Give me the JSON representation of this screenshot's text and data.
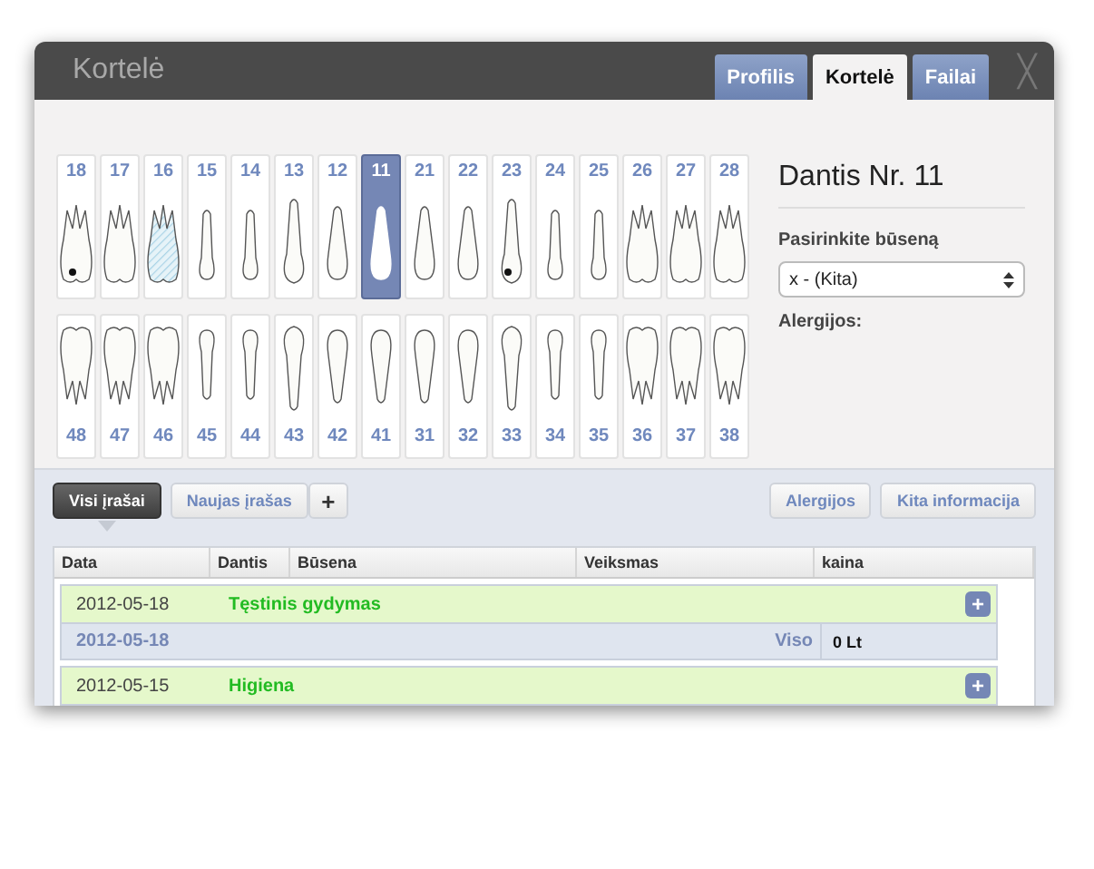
{
  "window": {
    "title": "Kortelė",
    "close_label": "╳"
  },
  "tabs": [
    {
      "label": "Profilis",
      "selected": false
    },
    {
      "label": "Kortelė",
      "selected": true
    },
    {
      "label": "Failai",
      "selected": false
    }
  ],
  "upper_teeth": [
    {
      "number": "18",
      "kind": "molar",
      "caries": true,
      "treated": false,
      "selected": false
    },
    {
      "number": "17",
      "kind": "molar",
      "caries": false,
      "treated": false,
      "selected": false
    },
    {
      "number": "16",
      "kind": "molar",
      "caries": false,
      "treated": true,
      "selected": false
    },
    {
      "number": "15",
      "kind": "premolar",
      "caries": false,
      "treated": false,
      "selected": false
    },
    {
      "number": "14",
      "kind": "premolar",
      "caries": false,
      "treated": false,
      "selected": false
    },
    {
      "number": "13",
      "kind": "canine",
      "caries": false,
      "treated": false,
      "selected": false
    },
    {
      "number": "12",
      "kind": "incisor",
      "caries": false,
      "treated": false,
      "selected": false
    },
    {
      "number": "11",
      "kind": "incisor",
      "caries": false,
      "treated": false,
      "selected": true
    },
    {
      "number": "21",
      "kind": "incisor",
      "caries": false,
      "treated": false,
      "selected": false
    },
    {
      "number": "22",
      "kind": "incisor",
      "caries": false,
      "treated": false,
      "selected": false
    },
    {
      "number": "23",
      "kind": "canine",
      "caries": true,
      "treated": false,
      "selected": false
    },
    {
      "number": "24",
      "kind": "premolar",
      "caries": false,
      "treated": false,
      "selected": false
    },
    {
      "number": "25",
      "kind": "premolar",
      "caries": false,
      "treated": false,
      "selected": false
    },
    {
      "number": "26",
      "kind": "molar",
      "caries": false,
      "treated": false,
      "selected": false
    },
    {
      "number": "27",
      "kind": "molar",
      "caries": false,
      "treated": false,
      "selected": false
    },
    {
      "number": "28",
      "kind": "molar",
      "caries": false,
      "treated": false,
      "selected": false
    }
  ],
  "lower_teeth": [
    {
      "number": "48",
      "kind": "molar",
      "caries": false,
      "treated": false,
      "selected": false
    },
    {
      "number": "47",
      "kind": "molar",
      "caries": false,
      "treated": false,
      "selected": false
    },
    {
      "number": "46",
      "kind": "molar",
      "caries": false,
      "treated": false,
      "selected": false
    },
    {
      "number": "45",
      "kind": "premolar",
      "caries": false,
      "treated": false,
      "selected": false
    },
    {
      "number": "44",
      "kind": "premolar",
      "caries": false,
      "treated": false,
      "selected": false
    },
    {
      "number": "43",
      "kind": "canine",
      "caries": false,
      "treated": false,
      "selected": false
    },
    {
      "number": "42",
      "kind": "incisor",
      "caries": false,
      "treated": false,
      "selected": false
    },
    {
      "number": "41",
      "kind": "incisor",
      "caries": false,
      "treated": false,
      "selected": false
    },
    {
      "number": "31",
      "kind": "incisor",
      "caries": false,
      "treated": false,
      "selected": false
    },
    {
      "number": "32",
      "kind": "incisor",
      "caries": false,
      "treated": false,
      "selected": false
    },
    {
      "number": "33",
      "kind": "canine",
      "caries": false,
      "treated": false,
      "selected": false
    },
    {
      "number": "34",
      "kind": "premolar",
      "caries": false,
      "treated": false,
      "selected": false
    },
    {
      "number": "35",
      "kind": "premolar",
      "caries": false,
      "treated": false,
      "selected": false
    },
    {
      "number": "36",
      "kind": "molar",
      "caries": false,
      "treated": false,
      "selected": false
    },
    {
      "number": "37",
      "kind": "molar",
      "caries": false,
      "treated": false,
      "selected": false
    },
    {
      "number": "38",
      "kind": "molar",
      "caries": false,
      "treated": false,
      "selected": false
    }
  ],
  "tooth_panel": {
    "title": "Dantis Nr. 11",
    "status_label": "Pasirinkite būseną",
    "status_value": "x - (Kita)",
    "allergies_label": "Alergijos:"
  },
  "record_tabs": [
    {
      "label": "Visi įrašai",
      "selected": true
    },
    {
      "label": "Naujas įrašas",
      "selected": false
    }
  ],
  "add_label": "+",
  "right_buttons": [
    "Alergijos",
    "Kita informacija"
  ],
  "table": {
    "columns": [
      "Data",
      "Dantis",
      "Būsena",
      "Veiksmas",
      "kaina"
    ],
    "entries": [
      {
        "date": "2012-05-18",
        "status": "Tęstinis gydymas",
        "expand": "+",
        "summary": {
          "date": "2012-05-18",
          "label": "Viso",
          "total": "0 Lt"
        }
      },
      {
        "date": "2012-05-15",
        "status": "Higiena",
        "expand": "+"
      }
    ]
  }
}
